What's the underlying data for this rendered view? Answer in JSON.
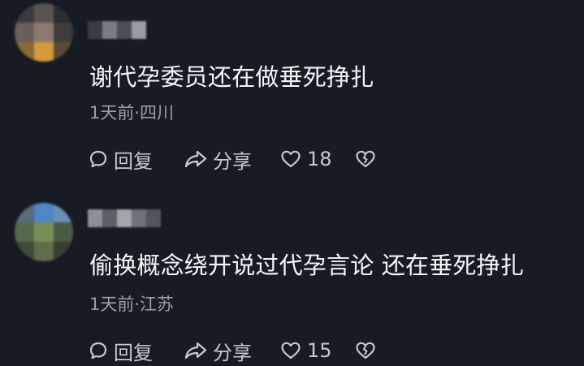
{
  "comments": [
    {
      "text": "谢代孕委员还在做垂死挣扎",
      "meta": "1天前·四川",
      "reply_label": "回复",
      "share_label": "分享",
      "like_count": "18"
    },
    {
      "text": "偷换概念绕开说过代孕言论 还在垂死挣扎",
      "meta": "1天前·江苏",
      "reply_label": "回复",
      "share_label": "分享",
      "like_count": "15"
    }
  ],
  "icons": {
    "reply": "comment-bubble-icon",
    "share": "share-arrow-icon",
    "like": "heart-outline-icon",
    "dislike": "broken-heart-icon"
  },
  "colors": {
    "background": "#161b24",
    "text_primary": "#f5f6f8",
    "text_secondary": "#9aa0ab",
    "action": "#c6cad2"
  }
}
